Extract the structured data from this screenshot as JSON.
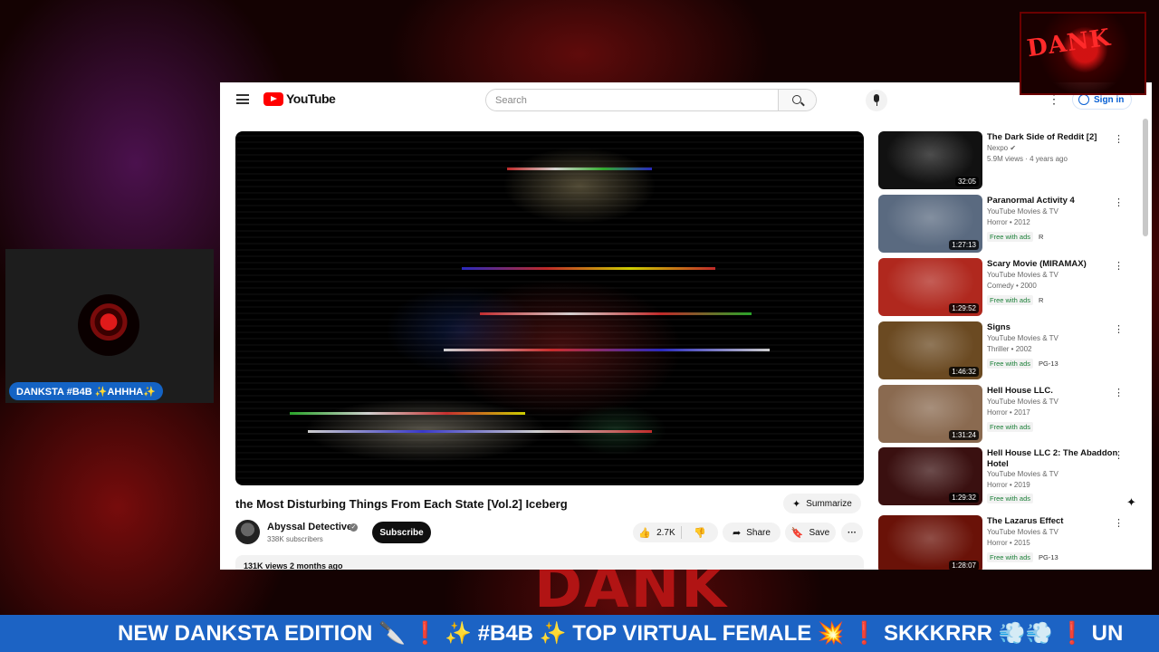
{
  "overlay": {
    "background_word": "DANK",
    "corner_logo_text": "DANK",
    "cam_label": "DANKSTA #B4B ✨AHHHA✨",
    "ticker": "NEW DANKSTA EDITION 🔪 ❗ ✨ #B4B ✨ TOP VIRTUAL FEMALE 💥 ❗ SKKKRRR 💨💨 ❗ UN"
  },
  "header": {
    "logo_text": "YouTube",
    "search_placeholder": "Search",
    "sign_in": "Sign in",
    "kebab": "⋮"
  },
  "video": {
    "title": "the Most Disturbing Things From Each State [Vol.2] Iceberg",
    "summarize_label": "Summarize",
    "channel_name": "Abyssal Detective",
    "subscribers": "338K subscribers",
    "subscribe_label": "Subscribe",
    "likes": "2.7K",
    "share_label": "Share",
    "save_label": "Save",
    "more_label": "···",
    "views_meta": "131K views  2 months ago"
  },
  "recommendations": [
    {
      "title": "The Dark Side of Reddit [2]",
      "channel": "Nexpo",
      "verified": true,
      "meta": "5.9M views · 4 years ago",
      "duration": "32:05",
      "free": "",
      "rating": "",
      "thumb_color": "#111111"
    },
    {
      "title": "Paranormal Activity 4",
      "channel": "YouTube Movies & TV",
      "verified": false,
      "meta": "Horror • 2012",
      "duration": "1:27:13",
      "free": "Free with ads",
      "rating": "R",
      "thumb_color": "#5a6a80"
    },
    {
      "title": "Scary Movie (MIRAMAX)",
      "channel": "YouTube Movies & TV",
      "verified": false,
      "meta": "Comedy • 2000",
      "duration": "1:29:52",
      "free": "Free with ads",
      "rating": "R",
      "thumb_color": "#b0281e"
    },
    {
      "title": "Signs",
      "channel": "YouTube Movies & TV",
      "verified": false,
      "meta": "Thriller • 2002",
      "duration": "1:46:32",
      "free": "Free with ads",
      "rating": "PG-13",
      "thumb_color": "#6b4a22"
    },
    {
      "title": "Hell House LLC.",
      "channel": "YouTube Movies & TV",
      "verified": false,
      "meta": "Horror • 2017",
      "duration": "1:31:24",
      "free": "Free with ads",
      "rating": "",
      "thumb_color": "#8a6a50"
    },
    {
      "title": "Hell House LLC 2: The Abaddon Hotel",
      "channel": "YouTube Movies & TV",
      "verified": false,
      "meta": "Horror • 2019",
      "duration": "1:29:32",
      "free": "Free with ads",
      "rating": "",
      "thumb_color": "#3a1010"
    },
    {
      "title": "The Lazarus Effect",
      "channel": "YouTube Movies & TV",
      "verified": false,
      "meta": "Horror • 2015",
      "duration": "1:28:07",
      "free": "Free with ads",
      "rating": "PG-13",
      "thumb_color": "#6a1208"
    }
  ]
}
